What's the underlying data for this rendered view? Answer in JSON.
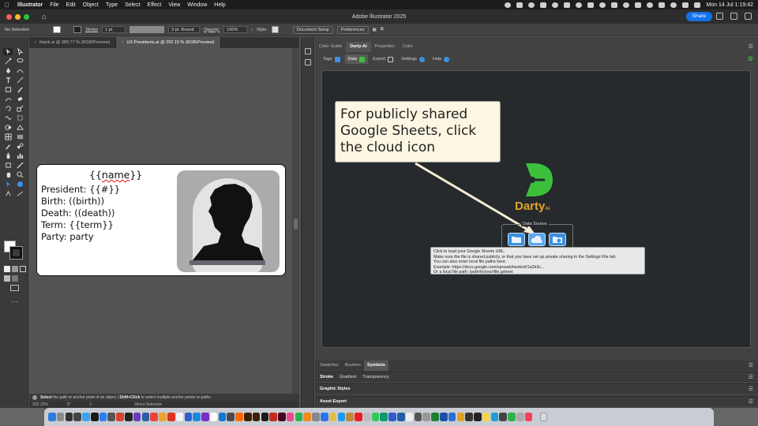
{
  "menubar": {
    "app_name": "Illustrator",
    "items": [
      "File",
      "Edit",
      "Object",
      "Type",
      "Select",
      "Effect",
      "View",
      "Window",
      "Help"
    ],
    "clock": "Mon 14 Jul  1:19:42"
  },
  "window": {
    "title": "Adobe Illustrator 2025",
    "share_label": "Share"
  },
  "controlbar": {
    "selection": "No Selection",
    "stroke_label": "Stroke",
    "stroke_value": "1 pt",
    "brush_value": "3 pt. Round",
    "opacity_label": "Opacity:",
    "opacity_value": "100%",
    "style_label": "Style:",
    "document_setup": "Document Setup",
    "preferences": "Preferences"
  },
  "documents": {
    "tabs": [
      {
        "label": "blank.ai @ 380.77 % (RGB/Preview)"
      },
      {
        "label": "US Presidents.ai @ 292.15 % (RGB/Preview)"
      }
    ]
  },
  "artboard": {
    "name_left": "{{",
    "name_word": "name",
    "name_right": "}}",
    "lines": [
      "President: {{#}}",
      "Birth: ((birth))",
      "Death: ((death))",
      "Term: {{term}}",
      "Party: party"
    ]
  },
  "status": {
    "prefix": "Select",
    "middle": " the path or anchor point of an object  |  ",
    "shift_click": "Shift+Click",
    "suffix": " to select multiple anchor points or paths",
    "zoom": "292.15%",
    "rotation": "0°",
    "artboard_num": "1",
    "tool_name": "Direct Selection"
  },
  "panel": {
    "tabs": [
      "Color Guide",
      "Darty-Ai",
      "Properties",
      "Color"
    ],
    "subtabs": [
      "Tags",
      "Data",
      "Export",
      "Settings",
      "Help"
    ]
  },
  "darty": {
    "callout": "For publicly shared Google Sheets, click the cloud icon",
    "logo_word": "Darty",
    "logo_suffix": "Ai",
    "data_source_label": "Data Source",
    "tooltip_lines": [
      "Click to load your Google Sheets URL.",
      "Make sure the file is shared publicly, or that you have set up private sharing in the Settings File tab.",
      "You can also enter local file paths here.",
      "Example: https://docs.google.com/spreadsheets/d/1a2b3c...",
      "Or a local file path: /path/to/your/file.gsheet"
    ]
  },
  "lower_panels": {
    "tabs": [
      "Swatches",
      "Brushes",
      "Symbols"
    ],
    "stroke_tabs": [
      "Stroke",
      "Gradient",
      "Transparency"
    ],
    "graphic_styles": "Graphic Styles",
    "asset_export": "Asset Export"
  },
  "colors": {
    "accent": "#1473e6",
    "darty_green": "#3cc03c",
    "darty_gold": "#e1a32a",
    "ds_button": "#3d8fe0",
    "callout_bg": "#fdf6e3"
  }
}
